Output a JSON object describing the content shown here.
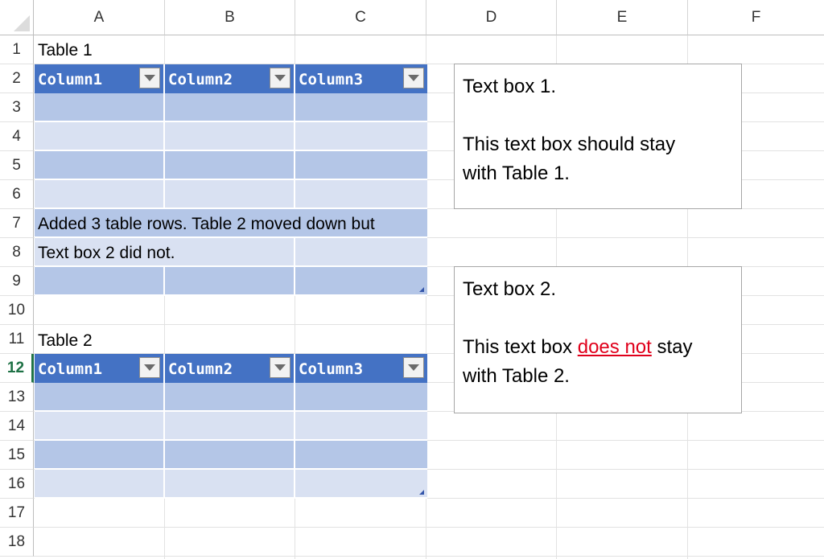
{
  "sheet": {
    "columns": [
      "A",
      "B",
      "C",
      "D",
      "E",
      "F"
    ],
    "rows": [
      "1",
      "2",
      "3",
      "4",
      "5",
      "6",
      "7",
      "8",
      "9",
      "10",
      "11",
      "12",
      "13",
      "14",
      "15",
      "16",
      "17",
      "18"
    ],
    "active_row": "12"
  },
  "cells": {
    "a1": "Table 1",
    "a7": "Added 3 table rows. Table 2 moved down but",
    "a8": "Text box 2 did not.",
    "a11": "Table 2"
  },
  "table1": {
    "headers": [
      "Column1",
      "Column2",
      "Column3"
    ]
  },
  "table2": {
    "headers": [
      "Column1",
      "Column2",
      "Column3"
    ]
  },
  "textbox1": {
    "line1": "Text box 1.",
    "line2": "This text box should stay",
    "line3": "with Table 1."
  },
  "textbox2": {
    "line1": "Text box 2.",
    "line2_before": "This text box ",
    "line2_highlight": "does not",
    "line2_after": " stay",
    "line3": "with Table 2."
  },
  "colors": {
    "table_header": "#4472c4",
    "band_dark": "#b4c6e7",
    "band_light": "#d9e1f2",
    "highlight_text": "#e0001b"
  }
}
